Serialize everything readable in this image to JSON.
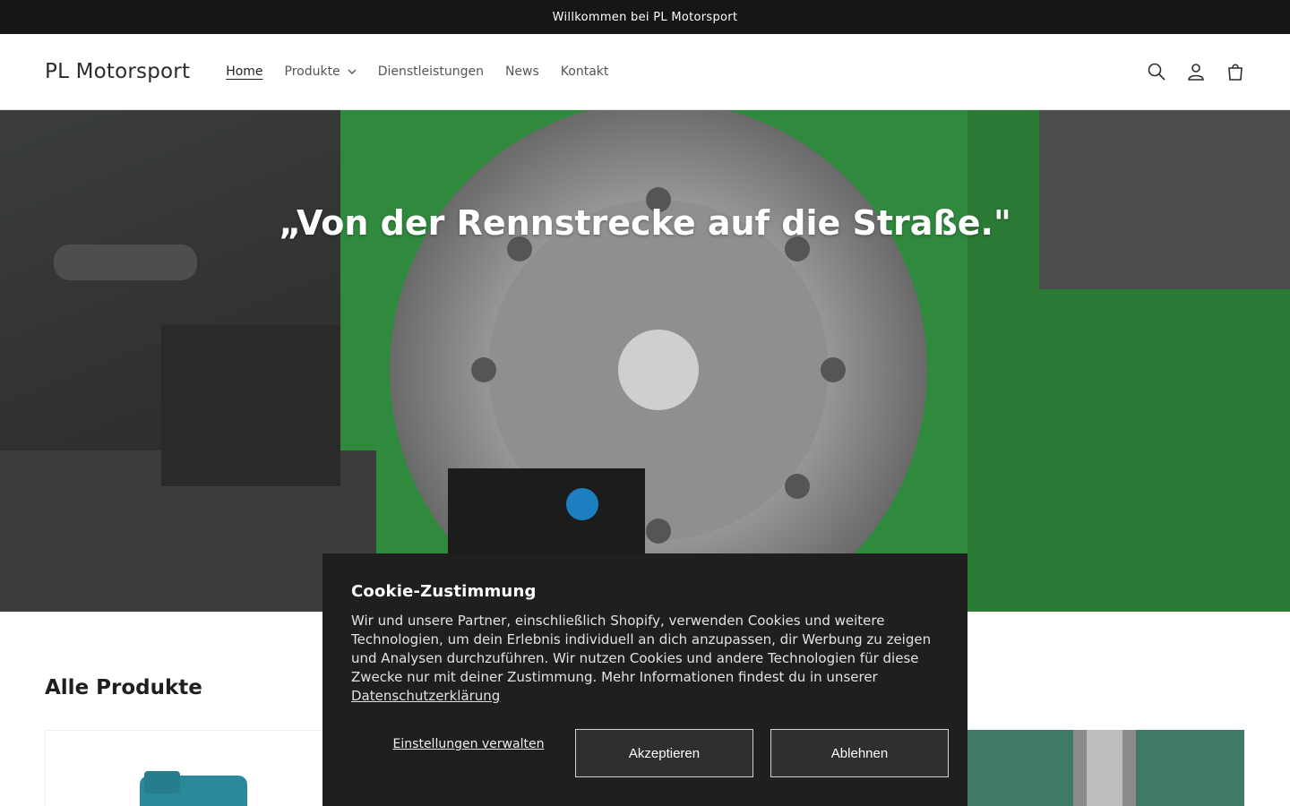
{
  "announcement": {
    "text": "Willkommen bei PL Motorsport"
  },
  "header": {
    "logo": "PL Motorsport",
    "nav": [
      {
        "label": "Home",
        "active": true
      },
      {
        "label": "Produkte",
        "has_dropdown": true
      },
      {
        "label": "Dienstleistungen"
      },
      {
        "label": "News"
      },
      {
        "label": "Kontakt"
      }
    ],
    "icons": [
      "search-icon",
      "account-icon",
      "cart-icon"
    ]
  },
  "hero": {
    "title": "„Von der Rennstrecke auf die Straße.\""
  },
  "products": {
    "title": "Alle Produkte"
  },
  "cookie": {
    "title": "Cookie-Zustimmung",
    "body": "Wir und unsere Partner, einschließlich Shopify, verwenden Cookies und weitere Technologien, um dein Erlebnis individuell an dich anzupassen, dir Werbung zu zeigen und Analysen durchzuführen. Wir nutzen Cookies und andere Technologien für diese Zwecke nur mit deiner Zustimmung. Mehr Informationen findest du in unserer",
    "link": "Datenschutzerklärung",
    "manage": "Einstellungen verwalten",
    "accept": "Akzeptieren",
    "decline": "Ablehnen"
  },
  "colors": {
    "announcement_bg": "#161616",
    "cookie_bg": "#1f1f1f",
    "hero_green": "#2f8a3e"
  }
}
